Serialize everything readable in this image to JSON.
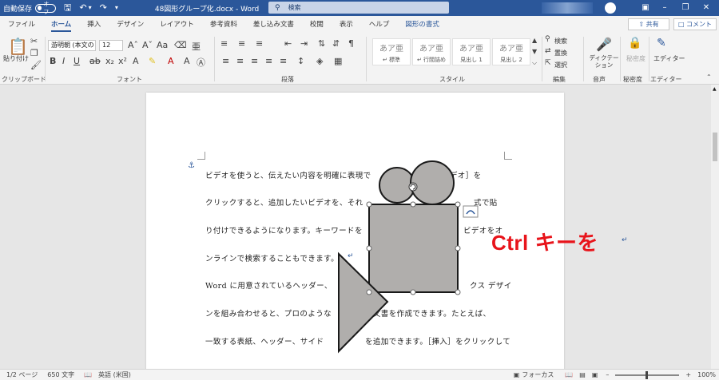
{
  "titlebar": {
    "autosave_label": "自動保存",
    "autosave_state": "オフ",
    "document_title": "48図形グループ化.docx - Word",
    "search_placeholder": "検索",
    "icons": [
      "save-icon",
      "undo-icon",
      "redo-icon",
      "customize-icon"
    ]
  },
  "tabs": [
    "ファイル",
    "ホーム",
    "挿入",
    "デザイン",
    "レイアウト",
    "参考資料",
    "差し込み文書",
    "校閲",
    "表示",
    "ヘルプ",
    "図形の書式"
  ],
  "active_tab": "ホーム",
  "share_label": "共有",
  "comment_label": "コメント",
  "ribbon": {
    "clipboard": {
      "paste_label": "貼り付け",
      "group_label": "クリップボード"
    },
    "font": {
      "font_name": "游明朝 (本文の",
      "font_size": "12",
      "group_label": "フォント"
    },
    "paragraph": {
      "group_label": "段落"
    },
    "styles": {
      "items": [
        {
          "preview": "あア亜",
          "name": "標準"
        },
        {
          "preview": "あア亜",
          "name": "行間詰め"
        },
        {
          "preview": "あア亜",
          "name": "見出し 1"
        },
        {
          "preview": "あア亜",
          "name": "見出し 2"
        }
      ],
      "group_label": "スタイル"
    },
    "editing": {
      "find": "検索",
      "replace": "置換",
      "select": "選択",
      "group_label": "編集"
    },
    "voice": {
      "dictate_label": "ディクテーション",
      "group_label": "音声"
    },
    "sensitivity": {
      "label": "秘密度",
      "group_label": "秘密度"
    },
    "editor": {
      "label": "エディター",
      "group_label": "エディター"
    }
  },
  "document": {
    "lines": [
      "ビデオを使うと、伝えたい内容を明確に表現で",
      "クリックすると、追加したいビデオを、それ",
      "り付けできるようになります。キーワードを",
      "ンラインで検索することもできます。",
      "Word に用意されているヘッダー、",
      "ンを組み合わせると、プロのような",
      "一致する表紙、ヘッダー、サイド",
      ""
    ],
    "right_fragments": [
      {
        "line": 0,
        "text": "ビデオ］を"
      },
      {
        "line": 1,
        "text": "式で貼"
      },
      {
        "line": 2,
        "text": "ビデオをオ"
      },
      {
        "line": 4,
        "text": "クス デザイ"
      },
      {
        "line": 5,
        "text": "の文書を作成できます。たとえば、"
      },
      {
        "line": 6,
        "text": "を追加できます。［挿入］をクリックして"
      }
    ]
  },
  "annotation": {
    "text": "Ctrl キーを",
    "color": "#e8141b"
  },
  "status": {
    "page": "1/2 ページ",
    "words": "650 文字",
    "language": "英語 (米国)",
    "focus": "フォーカス",
    "zoom": "100%"
  },
  "colors": {
    "title_bar": "#2b579a",
    "shape_fill": "#b0aeac",
    "shape_stroke": "#1a1a1a"
  }
}
